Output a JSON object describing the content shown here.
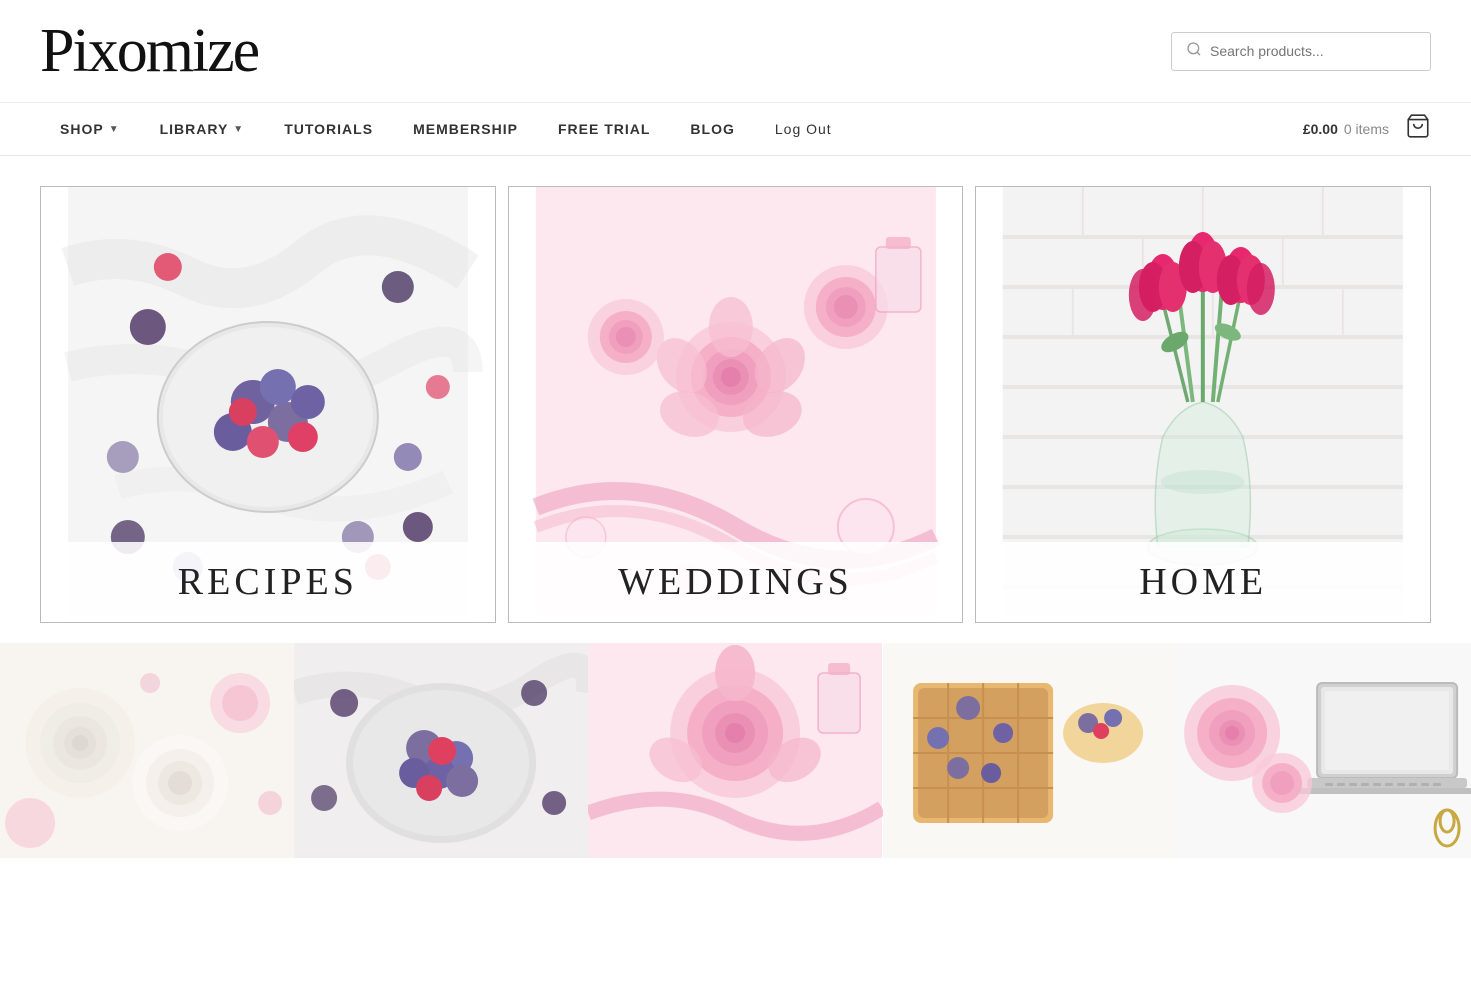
{
  "header": {
    "logo": "Pixomize",
    "search": {
      "placeholder": "Search products..."
    }
  },
  "nav": {
    "items": [
      {
        "label": "SHOP",
        "hasDropdown": true
      },
      {
        "label": "LIBRARY",
        "hasDropdown": true
      },
      {
        "label": "TUTORIALS",
        "hasDropdown": false
      },
      {
        "label": "MEMBERSHIP",
        "hasDropdown": false
      },
      {
        "label": "FREE TRIAL",
        "hasDropdown": false
      },
      {
        "label": "BLOG",
        "hasDropdown": false
      },
      {
        "label": "Log Out",
        "hasDropdown": false
      }
    ],
    "cart": {
      "price": "£0.00",
      "items_label": "0 items"
    }
  },
  "gallery": {
    "cards": [
      {
        "label": "RECIPES",
        "theme": "recipes"
      },
      {
        "label": "WEDDINGS",
        "theme": "weddings"
      },
      {
        "label": "HOME",
        "theme": "home"
      }
    ]
  },
  "bottom_strip": {
    "panels": [
      {
        "theme": "flowers-white"
      },
      {
        "theme": "berries"
      },
      {
        "theme": "roses-pink"
      },
      {
        "theme": "waffles"
      },
      {
        "theme": "laptop-roses"
      }
    ]
  }
}
